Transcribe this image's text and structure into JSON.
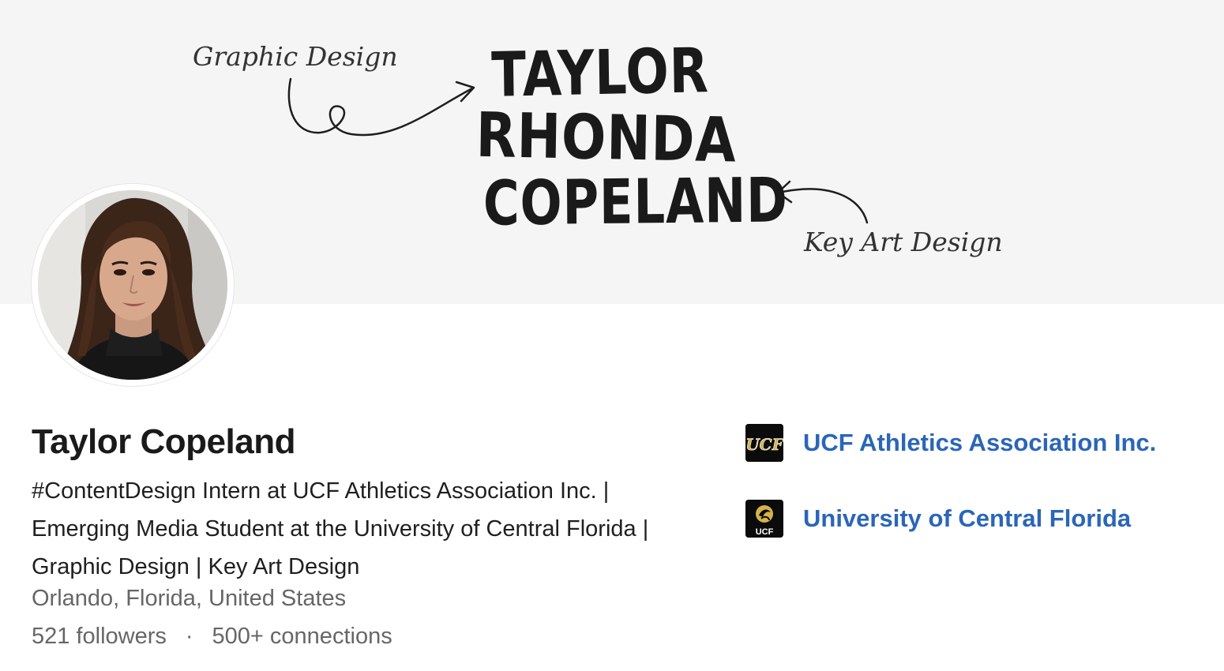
{
  "banner": {
    "graphic_label": "Graphic Design",
    "keyart_label": "Key Art Design",
    "name_lines": [
      "TAYLOR",
      "RHONDA",
      "COPELAND"
    ]
  },
  "profile": {
    "name": "Taylor Copeland",
    "headline": "#ContentDesign Intern at UCF Athletics Association Inc. | Emerging Media Student at the University of Central Florida | Graphic Design | Key Art Design",
    "location": "Orlando, Florida, United States",
    "followers": "521 followers",
    "separator": "·",
    "connections": "500+ connections"
  },
  "organizations": [
    {
      "name": "UCF Athletics Association Inc.",
      "logo_text": "UCF",
      "icon": "ucf-athletics-logo-icon"
    },
    {
      "name": "University of Central Florida",
      "logo_text": "UCF",
      "icon": "ucf-pegasus-logo-icon"
    }
  ],
  "colors": {
    "link": "#2a66b8",
    "banner_bg": "#f5f5f5",
    "gold": "#d6b44a",
    "muted_text": "#666666"
  }
}
